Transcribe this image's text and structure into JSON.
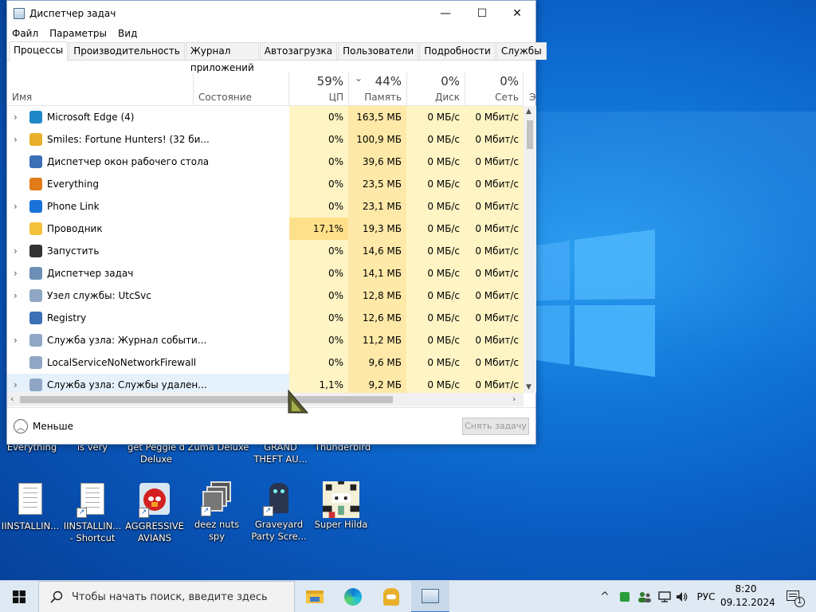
{
  "window": {
    "title": "Диспетчер задач",
    "min_glyph": "—",
    "max_glyph": "☐",
    "close_glyph": "✕"
  },
  "menu": [
    "Файл",
    "Параметры",
    "Вид"
  ],
  "tabs": [
    "Процессы",
    "Производительность",
    "Журнал приложений",
    "Автозагрузка",
    "Пользователи",
    "Подробности",
    "Службы"
  ],
  "columns": {
    "name": "Имя",
    "status": "Состояние",
    "cpu": {
      "pct": "59%",
      "label": "ЦП"
    },
    "mem": {
      "pct": "44%",
      "label": "Память",
      "sort_glyph": "⌄"
    },
    "disk": {
      "pct": "0%",
      "label": "Диск"
    },
    "net": {
      "pct": "0%",
      "label": "Сеть"
    },
    "more": "Э"
  },
  "processes": [
    {
      "name": "Microsoft Edge (4)",
      "cpu": "0%",
      "mem": "163,5 МБ",
      "disk": "0 МБ/с",
      "net": "0 Мбит/с",
      "expand": true,
      "icon": "edge-icon",
      "color": "#1e88c8"
    },
    {
      "name": "Smiles: Fortune Hunters! (32 би...",
      "cpu": "0%",
      "mem": "100,9 МБ",
      "disk": "0 МБ/с",
      "net": "0 Мбит/с",
      "expand": true,
      "icon": "smiles-icon",
      "color": "#e8b02a"
    },
    {
      "name": "Диспетчер окон рабочего стола",
      "cpu": "0%",
      "mem": "39,6 МБ",
      "disk": "0 МБ/с",
      "net": "0 Мбит/с",
      "expand": false,
      "icon": "dwm-icon",
      "color": "#3b6fb6"
    },
    {
      "name": "Everything",
      "cpu": "0%",
      "mem": "23,5 МБ",
      "disk": "0 МБ/с",
      "net": "0 Мбит/с",
      "expand": false,
      "icon": "everything-icon",
      "color": "#e07b1a"
    },
    {
      "name": "Phone Link",
      "cpu": "0%",
      "mem": "23,1 МБ",
      "disk": "0 МБ/с",
      "net": "0 Мбит/с",
      "expand": true,
      "icon": "phone-link-icon",
      "color": "#1a73d9"
    },
    {
      "name": "Проводник",
      "cpu": "17,1%",
      "mem": "19,3 МБ",
      "disk": "0 МБ/с",
      "net": "0 Мбит/с",
      "expand": false,
      "icon": "explorer-icon",
      "color": "#f2c23c"
    },
    {
      "name": "Запустить",
      "cpu": "0%",
      "mem": "14,6 МБ",
      "disk": "0 МБ/с",
      "net": "0 Мбит/с",
      "expand": true,
      "icon": "run-icon",
      "color": "#333333"
    },
    {
      "name": "Диспетчер задач",
      "cpu": "0%",
      "mem": "14,1 МБ",
      "disk": "0 МБ/с",
      "net": "0 Мбит/с",
      "expand": true,
      "icon": "task-manager-icon",
      "color": "#6c8fb5"
    },
    {
      "name": "Узел службы: UtcSvc",
      "cpu": "0%",
      "mem": "12,8 МБ",
      "disk": "0 МБ/с",
      "net": "0 Мбит/с",
      "expand": true,
      "icon": "service-icon",
      "color": "#8fa7c4"
    },
    {
      "name": "Registry",
      "cpu": "0%",
      "mem": "12,6 МБ",
      "disk": "0 МБ/с",
      "net": "0 Мбит/с",
      "expand": false,
      "icon": "registry-icon",
      "color": "#3b6fb6"
    },
    {
      "name": "Служба узла: Журнал событи...",
      "cpu": "0%",
      "mem": "11,2 МБ",
      "disk": "0 МБ/с",
      "net": "0 Мбит/с",
      "expand": true,
      "icon": "service-icon",
      "color": "#8fa7c4"
    },
    {
      "name": "LocalServiceNoNetworkFirewall",
      "cpu": "0%",
      "mem": "9,6 МБ",
      "disk": "0 МБ/с",
      "net": "0 Мбит/с",
      "expand": false,
      "icon": "service-icon",
      "color": "#8fa7c4"
    },
    {
      "name": "Служба узла: Службы удален...",
      "cpu": "1,1%",
      "mem": "9,2 МБ",
      "disk": "0 МБ/с",
      "net": "0 Мбит/с",
      "expand": true,
      "icon": "service-icon",
      "color": "#8fa7c4"
    }
  ],
  "footer": {
    "less": "Меньше",
    "end_task": "Снять задачу"
  },
  "desktop_top_labels": [
    "Everything",
    "is very",
    "get Peggle d\nDeluxe",
    "Zuma Deluxe",
    "GRAND\nTHEFT AU...",
    "Thunderbird"
  ],
  "desktop_icons": [
    {
      "label": "IINSTALLIN...",
      "icon": "text-file-icon"
    },
    {
      "label": "IINSTALLIN...\n- Shortcut",
      "icon": "text-file-shortcut-icon"
    },
    {
      "label": "AGGRESSIVE\nAVIANS",
      "icon": "angry-bird-icon"
    },
    {
      "label": "deez nuts spy",
      "icon": "stacked-windows-icon"
    },
    {
      "label": "Graveyard\nParty Scre...",
      "icon": "graveyard-icon"
    },
    {
      "label": "Super Hilda",
      "icon": "pixel-art-icon"
    }
  ],
  "taskbar": {
    "search_placeholder": "Чтобы начать поиск, введите здесь",
    "lang": "РУС",
    "time": "8:20",
    "date": "09.12.2024",
    "tray_chevron": "^",
    "notification_count": "1"
  },
  "colors": {
    "accent": "#0078d7",
    "cpu_heat": "#fff4c4",
    "cpu_heat_high": "#ffe08a",
    "mem_heat": "#ffe9a8",
    "taskbar": "#dfe9f3"
  }
}
